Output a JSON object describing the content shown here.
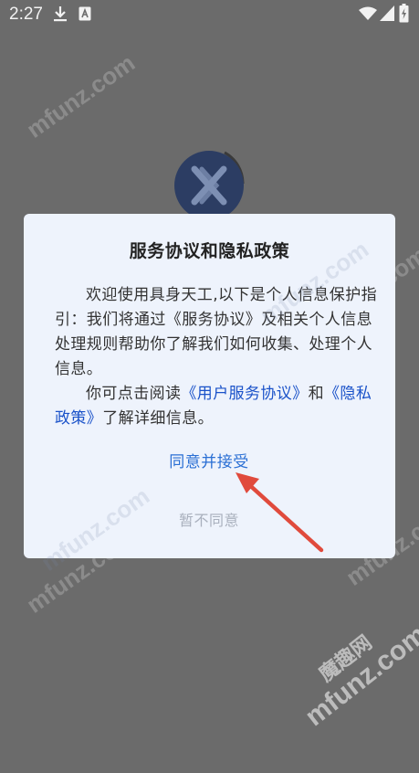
{
  "status_bar": {
    "time": "2:27",
    "icons": [
      "download-icon",
      "a-letter-icon",
      "wifi-icon",
      "signal-icon",
      "battery-charging-icon"
    ]
  },
  "dialog": {
    "title": "服务协议和隐私政策",
    "para1": "欢迎使用具身天工,以下是个人信息保护指引：我们将通过《服务协议》及相关个人信息处理规则帮助你了解我们如何收集、处理个人信息。",
    "para2_prefix": "你可点击阅读",
    "link_user_agreement": "《用户服务协议》",
    "para2_and": "和",
    "link_privacy": "《隐私政策》",
    "para2_suffix": "了解详细信息。",
    "agree_label": "同意并接受",
    "disagree_label": "暂不同意"
  },
  "watermark": {
    "text": "mfunz.com",
    "brand_cn": "魔趣网",
    "brand_en": "mfunz.com"
  },
  "colors": {
    "overlay": "#6b6b6b",
    "dialog_bg": "#eef3fc",
    "link": "#1a52c9",
    "agree": "#2a6fd4",
    "disagree": "#a9b0bd",
    "arrow": "#e04a3c",
    "logo": "#2c3d63"
  }
}
